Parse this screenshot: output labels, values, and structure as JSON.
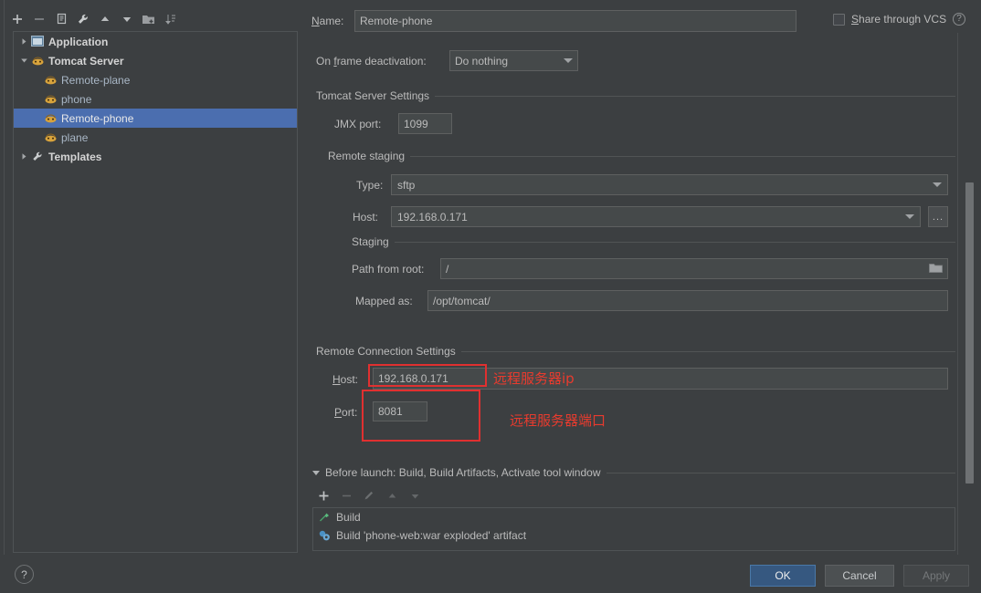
{
  "tree": {
    "toolbar": [
      {
        "name": "add-icon",
        "label": "+"
      },
      {
        "name": "remove-icon",
        "label": "−"
      },
      {
        "name": "copy-icon",
        "label": "copy"
      },
      {
        "name": "edit-templates-icon",
        "label": "wrench"
      },
      {
        "name": "move-up-icon",
        "label": "up"
      },
      {
        "name": "move-down-icon",
        "label": "down"
      },
      {
        "name": "move-into-folder-icon",
        "label": "folder"
      },
      {
        "name": "sort-icon",
        "label": "sort"
      }
    ],
    "items": [
      {
        "label": "Application",
        "level": 1,
        "expander": "collapsed",
        "icon": "application-icon",
        "bold": true,
        "selected": false
      },
      {
        "label": "Tomcat Server",
        "level": 1,
        "expander": "expanded",
        "icon": "tomcat-icon",
        "bold": true,
        "selected": false
      },
      {
        "label": "Remote-plane",
        "level": 2,
        "expander": "none",
        "icon": "tomcat-icon",
        "bold": false,
        "selected": false
      },
      {
        "label": "phone",
        "level": 2,
        "expander": "none",
        "icon": "tomcat-icon",
        "bold": false,
        "selected": false
      },
      {
        "label": "Remote-phone",
        "level": 2,
        "expander": "none",
        "icon": "tomcat-icon",
        "bold": false,
        "selected": true
      },
      {
        "label": "plane",
        "level": 2,
        "expander": "none",
        "icon": "tomcat-icon",
        "bold": false,
        "selected": false
      },
      {
        "label": "Templates",
        "level": 1,
        "expander": "collapsed",
        "icon": "templates-icon",
        "bold": true,
        "selected": false
      }
    ]
  },
  "main": {
    "name_label": "Name:",
    "name_value": "Remote-phone",
    "share_vcs_label": "Share through VCS",
    "help_glyph": "?",
    "on_frame_deactivation_label": "On frame deactivation:",
    "on_frame_deactivation_value": "Do nothing",
    "tomcat_group_title": "Tomcat Server Settings",
    "jmx_port_label": "JMX port:",
    "jmx_port_value": "1099",
    "remote_staging_group_title": "Remote staging",
    "type_label": "Type:",
    "type_value": "sftp",
    "staging_host_label": "Host:",
    "staging_host_value": "192.168.0.171",
    "browse_button_label": "...",
    "staging_group_title": "Staging",
    "path_from_root_label": "Path from root:",
    "path_from_root_value": "/",
    "mapped_as_label": "Mapped as:",
    "mapped_as_value": "/opt/tomcat/",
    "remote_connection_group_title": "Remote Connection Settings",
    "remote_host_label": "Host:",
    "remote_host_value": "192.168.0.171",
    "remote_port_label": "Port:",
    "remote_port_value": "8081"
  },
  "annotations": [
    {
      "text": "远程服务器ip",
      "color": "#e83b2e"
    },
    {
      "text": "远程服务器端口",
      "color": "#e83b2e"
    }
  ],
  "before_launch": {
    "header": "Before launch: Build, Build Artifacts, Activate tool window",
    "toolbar": [
      {
        "name": "add-task-icon",
        "label": "+",
        "enabled": true
      },
      {
        "name": "remove-task-icon",
        "label": "−",
        "enabled": false
      },
      {
        "name": "edit-task-icon",
        "label": "pencil",
        "enabled": false
      },
      {
        "name": "move-task-up-icon",
        "label": "up",
        "enabled": false
      },
      {
        "name": "move-task-down-icon",
        "label": "down",
        "enabled": false
      }
    ],
    "tasks": [
      {
        "icon": "build-hammer-icon",
        "label": "Build"
      },
      {
        "icon": "build-artifact-icon",
        "label": "Build 'phone-web:war exploded' artifact"
      }
    ]
  },
  "footer": {
    "help_glyph": "?",
    "ok_label": "OK",
    "cancel_label": "Cancel",
    "apply_label": "Apply"
  },
  "theme": {
    "background": "#3c3f41",
    "selection": "#4b6eaf",
    "field_background": "#45494a",
    "accent_ok": "#365880",
    "annotation_red": "#e83b2e"
  }
}
